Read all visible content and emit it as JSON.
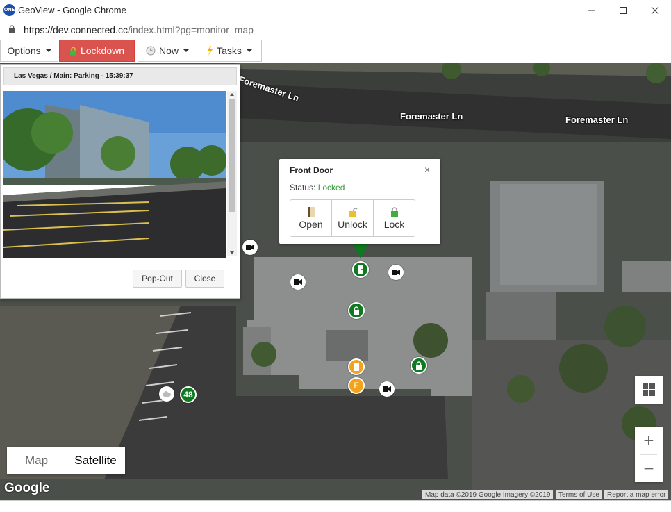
{
  "window": {
    "title": "GeoView - Google Chrome",
    "app_icon": "ONE"
  },
  "address": {
    "url_host": "https://dev.connected.cc",
    "url_path": "/index.html?pg=monitor_map"
  },
  "toolbar": {
    "options_label": "Options",
    "lockdown_label": "Lockdown",
    "now_label": "Now",
    "tasks_label": "Tasks",
    "lockdown_color": "#d9534f"
  },
  "map": {
    "streets": [
      {
        "name": "Foremaster Ln"
      },
      {
        "name": "Foremaster Ln"
      },
      {
        "name": "Foremaster Ln"
      }
    ],
    "cluster_count": "48",
    "marker_f_label": "F",
    "map_type": {
      "map_label": "Map",
      "satellite_label": "Satellite"
    },
    "zoom_in": "+",
    "zoom_out": "−",
    "google_label": "Google",
    "attribution": {
      "data": "Map data ©2019 Google Imagery ©2019",
      "terms": "Terms of Use",
      "report": "Report a map error"
    }
  },
  "camera_panel": {
    "title": "Las Vegas / Main: Parking - 15:39:37",
    "popout_label": "Pop-Out",
    "close_label": "Close"
  },
  "info_window": {
    "title": "Front Door",
    "status_label": "Status:",
    "status_value": "Locked",
    "close_symbol": "×",
    "buttons": {
      "open": "Open",
      "unlock": "Unlock",
      "lock": "Lock"
    }
  }
}
